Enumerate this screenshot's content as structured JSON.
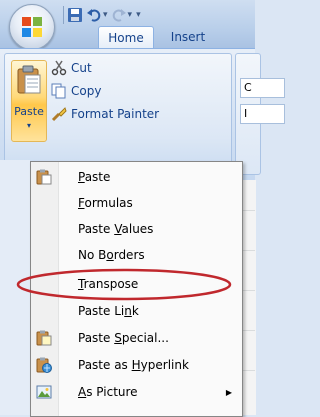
{
  "title_bar": {
    "qat_icons": [
      "save-icon",
      "undo-icon",
      "redo-icon",
      "customize-icon"
    ]
  },
  "tabs": [
    {
      "label": "Home",
      "active": true
    },
    {
      "label": "Insert",
      "active": false
    }
  ],
  "clipboard_group": {
    "paste_label": "Paste",
    "cut_label": "Cut",
    "copy_label": "Copy",
    "format_painter_label": "Format Painter"
  },
  "next_group": {
    "box1": "C",
    "box2": "I"
  },
  "paste_menu": {
    "items": [
      {
        "pre": "",
        "accel": "P",
        "post": "aste",
        "icon": "paste-icon"
      },
      {
        "pre": "",
        "accel": "F",
        "post": "ormulas",
        "icon": ""
      },
      {
        "pre": "Paste ",
        "accel": "V",
        "post": "alues",
        "icon": ""
      },
      {
        "pre": "No B",
        "accel": "o",
        "post": "rders",
        "icon": ""
      },
      {
        "pre": "",
        "accel": "T",
        "post": "ranspose",
        "icon": ""
      },
      {
        "pre": "Paste Li",
        "accel": "n",
        "post": "k",
        "icon": ""
      },
      {
        "pre": "Paste ",
        "accel": "S",
        "post": "pecial...",
        "icon": "paste-special-icon"
      },
      {
        "pre": "Paste as ",
        "accel": "H",
        "post": "yperlink",
        "icon": "paste-hyperlink-icon"
      },
      {
        "pre": "",
        "accel": "A",
        "post": "s Picture",
        "icon": "picture-icon",
        "submenu": true
      }
    ]
  },
  "annotation": {
    "highlight_color": "#c0282d",
    "highlighted_item": "Transpose"
  }
}
